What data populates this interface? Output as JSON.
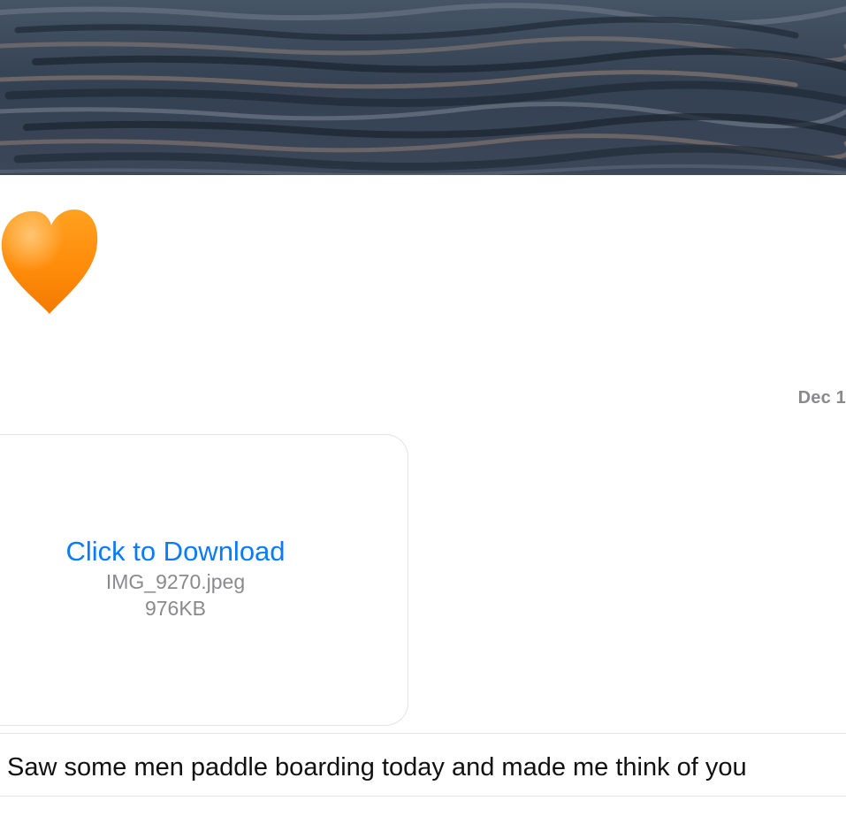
{
  "conversation": {
    "photo": {
      "icon": "ocean-water-photo"
    },
    "reaction": {
      "icon": "orange-heart-icon",
      "color": "#ff8c0a"
    },
    "timestamp": "Dec 1",
    "attachment": {
      "action_label": "Click to Download",
      "file_name": "IMG_9270.jpeg",
      "file_size": "976KB",
      "link_color": "#0a7aff"
    },
    "message": {
      "text": "Saw some men paddle boarding today and made me think of you"
    }
  }
}
